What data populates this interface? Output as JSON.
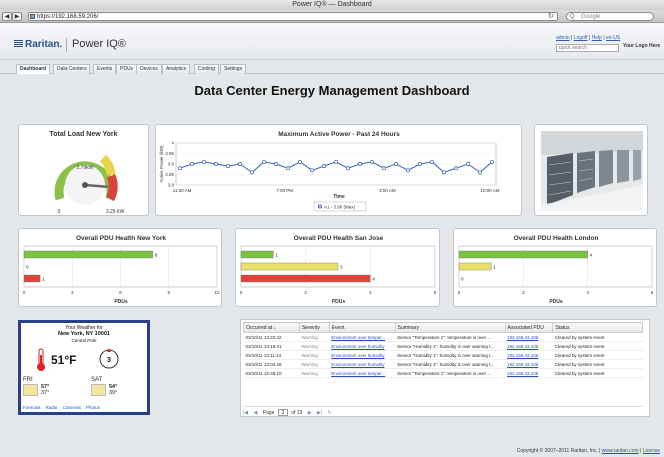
{
  "browser": {
    "window_title": "Power IQ® — Dashboard",
    "url": "https://192.168.59.206/",
    "search_placeholder": "Google",
    "back": "◀",
    "forward": "▶",
    "add": "+",
    "reload": "↻"
  },
  "header": {
    "brand": "Raritan.",
    "product": "Power IQ®",
    "links": [
      "admin",
      "Logoff",
      "Help",
      "en-US"
    ],
    "link_sep": "|",
    "quick_search_placeholder": "quick search",
    "your_logo": "Your Logo Here"
  },
  "tabs": [
    "Dashboard",
    "Data Centers",
    "Events",
    "PDUs",
    "Devices",
    "Analytics",
    "Cooling",
    "Settings"
  ],
  "page_title": "Data Center Energy Management Dashboard",
  "gauge": {
    "title": "Total Load New York",
    "value_label": "2.79kW",
    "min_label": "0",
    "max_label": "3.29 kW",
    "needle_fraction": 0.85
  },
  "chart_data": [
    {
      "type": "line",
      "title": "Maximum Active Power - Past 24 Hours",
      "xlabel": "Time",
      "ylabel": "Active Power (kW)",
      "yticks": [
        "4",
        "3.95",
        "3.9",
        "3.85",
        "3.8"
      ],
      "ylim": [
        3.8,
        4.0
      ],
      "xticks": [
        "11:00 AM",
        "7:00 PM",
        "3:00 AM",
        "10:00 AM"
      ],
      "series": [
        {
          "name": "A1 - 3.90 (Max)",
          "values": [
            3.88,
            3.9,
            3.91,
            3.9,
            3.89,
            3.9,
            3.86,
            3.91,
            3.9,
            3.88,
            3.91,
            3.87,
            3.89,
            3.91,
            3.88,
            3.9,
            3.91,
            3.88,
            3.9,
            3.87,
            3.9,
            3.91,
            3.86,
            3.88,
            3.9,
            3.86,
            3.91
          ]
        }
      ]
    },
    {
      "type": "bar",
      "title": "Overall PDU Health New York",
      "xlabel": "PDUs",
      "xticks": [
        "0",
        "3",
        "6",
        "9",
        "12"
      ],
      "xlim": [
        0,
        12
      ],
      "categories": [
        "Normal",
        "Warning",
        "Critical"
      ],
      "values": [
        8,
        0,
        1
      ]
    },
    {
      "type": "bar",
      "title": "Overall PDU Health San Jose",
      "xlabel": "PDUs",
      "xticks": [
        "0",
        "2",
        "4",
        "6"
      ],
      "xlim": [
        0,
        6
      ],
      "categories": [
        "Normal",
        "Warning",
        "Critical"
      ],
      "values": [
        1,
        3,
        4
      ]
    },
    {
      "type": "bar",
      "title": "Overall PDU Health London",
      "xlabel": "PDUs",
      "xticks": [
        "0",
        "2",
        "4",
        "6"
      ],
      "xlim": [
        0,
        6
      ],
      "categories": [
        "Normal",
        "Warning",
        "Critical"
      ],
      "values": [
        4,
        1,
        0
      ]
    }
  ],
  "weather": {
    "heading": "Your Weather for",
    "city": "New York, NY 10001",
    "subcity": "Central Park",
    "temp": "51°F",
    "wind": "3",
    "days": [
      {
        "name": "FRI",
        "high": "57°",
        "low": "37°"
      },
      {
        "name": "SAT",
        "high": "54°",
        "low": "39°"
      }
    ],
    "links": [
      "Forecast",
      "Radar",
      "Cameras",
      "Photos"
    ]
  },
  "events": {
    "columns": [
      "Occurred at ↓",
      "Severity",
      "Event",
      "Summary",
      "Associated PDU",
      "Status"
    ],
    "rows": [
      [
        "03/10/11 13:22:42",
        "Warning",
        "Environment over temper...",
        "Sensor \"Temperature 1\": temperature is over ...",
        "192.168.43.106",
        "Cleared by system event"
      ],
      [
        "03/10/11 13:19:21",
        "Warning",
        "Environment over humidity",
        "Sensor \"Humidity 1\": humidity is over warning t...",
        "192.168.43.106",
        "Cleared by system event"
      ],
      [
        "03/10/11 13:11:24",
        "Warning",
        "Environment over humidity",
        "Sensor \"Humidity 1\": humidity is over warning t...",
        "192.168.43.106",
        "Cleared by system event"
      ],
      [
        "03/10/11 13:02:26",
        "Warning",
        "Environment over humidity",
        "Sensor \"Humidity 1\": humidity is over warning t...",
        "192.168.43.106",
        "Cleared by system event"
      ],
      [
        "03/10/11 12:45:10",
        "Warning",
        "Environment over temper...",
        "Sensor \"Temperature 1\": temperature is over ...",
        "192.168.43.106",
        "Cleared by system event"
      ]
    ],
    "pager": {
      "page_label": "Page",
      "page": "3",
      "of": "of 23"
    }
  },
  "footer": {
    "text": "Copyright © 2007–2011 Raritan, Inc. |",
    "link1": "www.raritan.com",
    "sep": "|",
    "link2": "License"
  }
}
